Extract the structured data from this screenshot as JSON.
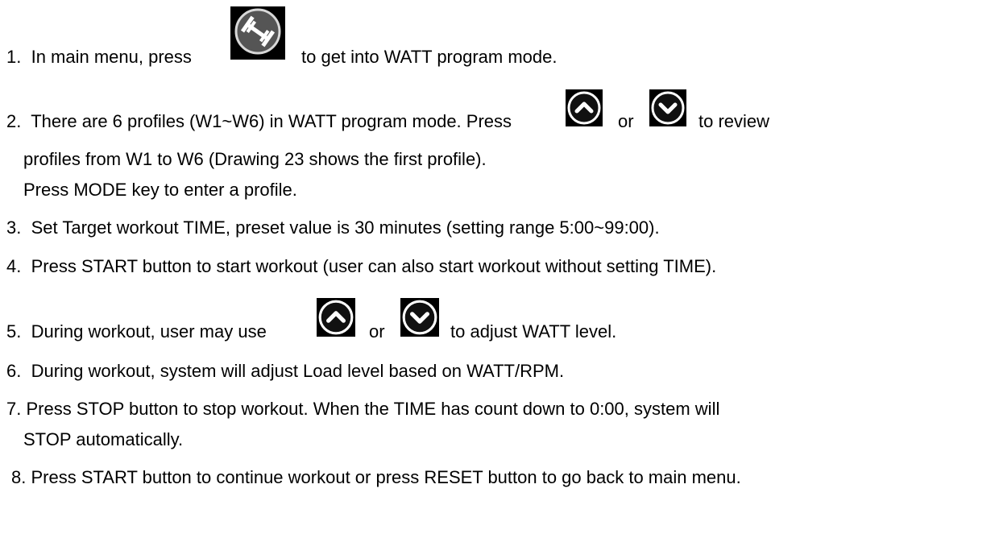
{
  "steps": [
    {
      "num": "1.",
      "text_before": "In main menu, press",
      "text_after": "to get into WATT program mode."
    },
    {
      "num": "2.",
      "text_before": "There are 6 profiles (W1~W6) in WATT program mode. Press",
      "or": "or",
      "text_after": "to review",
      "cont1": "profiles from W1 to W6 (Drawing 23 shows the first profile).",
      "cont2": "Press MODE key to enter a profile."
    },
    {
      "num": "3.",
      "text": "Set Target workout TIME, preset value is 30 minutes (setting range 5:00~99:00)."
    },
    {
      "num": "4.",
      "text": "Press START button to start workout (user can also start workout without setting TIME)."
    },
    {
      "num": "5.",
      "text_before": "During workout, user may use",
      "or": "or",
      "text_after": "to adjust WATT level."
    },
    {
      "num": "6.",
      "text": "During workout, system will adjust Load level based on WATT/RPM."
    },
    {
      "num": "7.",
      "text": "Press STOP button to stop workout. When the TIME has count down to 0:00, system will",
      "cont1": "STOP automatically."
    },
    {
      "num": "8.",
      "text": "Press START button to continue workout or press RESET button to go back to main menu."
    }
  ],
  "icons": {
    "watt": "dumbbell-icon",
    "up": "chevron-up-icon",
    "down": "chevron-down-icon"
  }
}
